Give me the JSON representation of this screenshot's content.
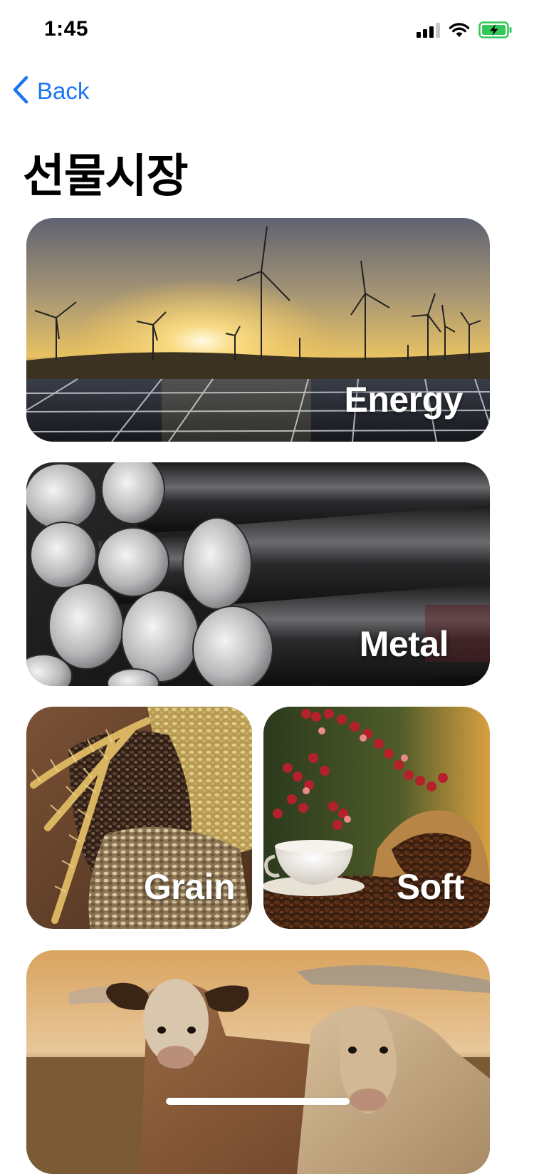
{
  "status_bar": {
    "time": "1:45",
    "icons": [
      "cellular-signal-icon",
      "wifi-icon",
      "battery-charging-icon"
    ]
  },
  "nav": {
    "back_label": "Back",
    "back_icon": "chevron-left-icon",
    "accent_color": "#1a76f0"
  },
  "page": {
    "title": "선물시장"
  },
  "categories": [
    {
      "label": "Energy"
    },
    {
      "label": "Metal"
    },
    {
      "label": "Grain"
    },
    {
      "label": "Soft"
    },
    {
      "label": ""
    }
  ]
}
